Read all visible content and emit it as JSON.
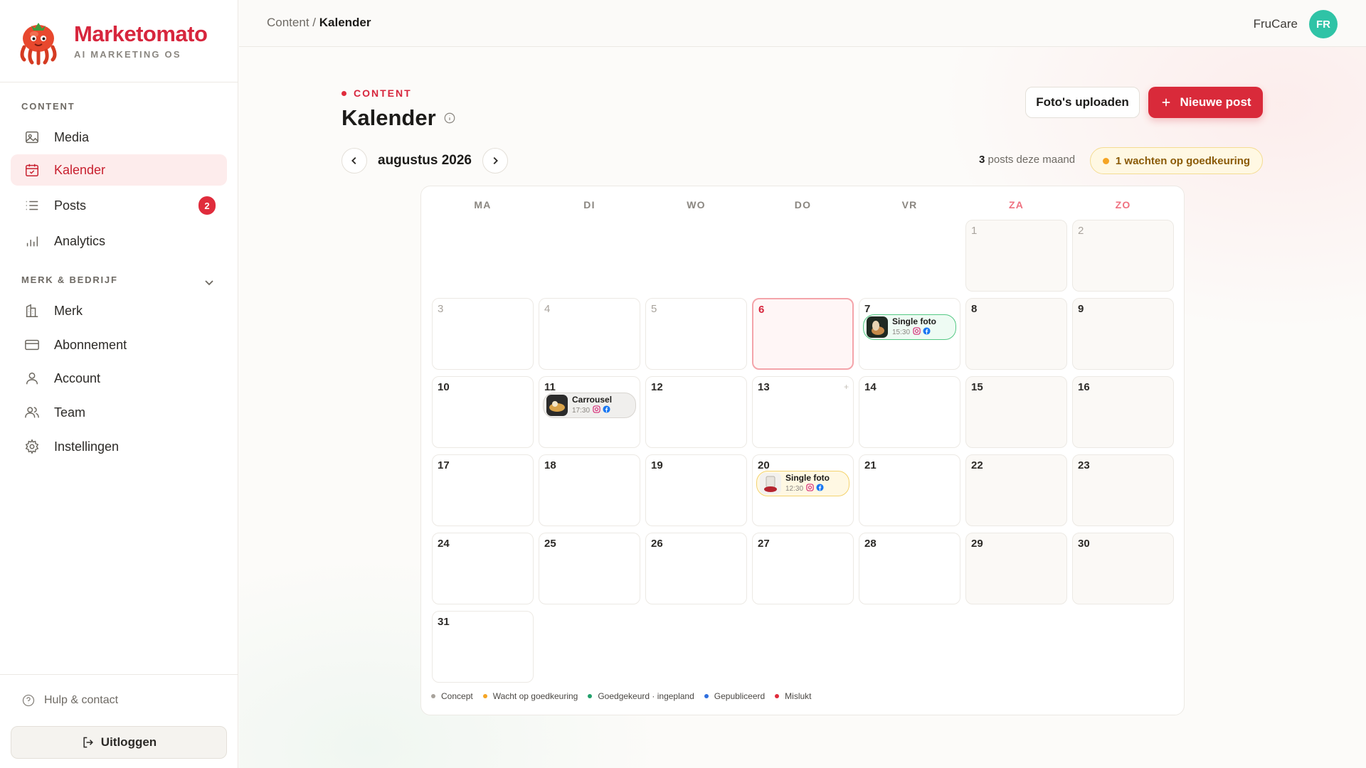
{
  "brand": {
    "name": "Marketomato",
    "tagline": "AI MARKETING OS"
  },
  "sidebar": {
    "content_label": "CONTENT",
    "items": [
      {
        "label": "Media",
        "icon": "image-icon"
      },
      {
        "label": "Kalender",
        "icon": "calendar-icon",
        "active": true
      },
      {
        "label": "Posts",
        "icon": "list-icon",
        "badge": "2"
      },
      {
        "label": "Analytics",
        "icon": "bar-chart-icon"
      }
    ],
    "company_label": "MERK & BEDRIJF",
    "company_items": [
      {
        "label": "Merk",
        "icon": "building-icon"
      },
      {
        "label": "Abonnement",
        "icon": "credit-card-icon"
      },
      {
        "label": "Account",
        "icon": "user-icon"
      },
      {
        "label": "Team",
        "icon": "users-icon"
      },
      {
        "label": "Instellingen",
        "icon": "gear-icon"
      }
    ],
    "help": "Hulp & contact",
    "logout": "Uitloggen"
  },
  "topbar": {
    "breadcrumb_parent": "Content",
    "breadcrumb_sep": "/",
    "breadcrumb_current": "Kalender",
    "user_name": "FruCare",
    "avatar_initials": "FR"
  },
  "header": {
    "eyebrow": "CONTENT",
    "title": "Kalender",
    "upload_button": "Foto's uploaden",
    "new_post_button": "Nieuwe post"
  },
  "month": {
    "label": "augustus 2026",
    "post_count": "3",
    "post_count_suffix": "posts deze maand",
    "pending": "1 wachten op goedkeuring"
  },
  "calendar": {
    "weekdays": [
      "MA",
      "DI",
      "WO",
      "DO",
      "VR",
      "ZA",
      "ZO"
    ],
    "today": 6,
    "days": [
      1,
      2,
      3,
      4,
      5,
      6,
      7,
      8,
      9,
      10,
      11,
      12,
      13,
      14,
      15,
      16,
      17,
      18,
      19,
      20,
      21,
      22,
      23,
      24,
      25,
      26,
      27,
      28,
      29,
      30,
      31
    ],
    "posts": [
      {
        "day": 7,
        "title": "Single foto",
        "time": "15:30",
        "status": "approved"
      },
      {
        "day": 11,
        "title": "Carrousel",
        "time": "17:30",
        "status": "concept"
      },
      {
        "day": 20,
        "title": "Single foto",
        "time": "12:30",
        "status": "pending"
      }
    ]
  },
  "legend": [
    {
      "label": "Concept",
      "color": "#a8a39c"
    },
    {
      "label": "Wacht op goedkeuring",
      "color": "#f5a524"
    },
    {
      "label": "Goedgekeurd · ingepland",
      "color": "#22a06b"
    },
    {
      "label": "Gepubliceerd",
      "color": "#2f6fde"
    },
    {
      "label": "Mislukt",
      "color": "#e02c3c"
    }
  ],
  "colors": {
    "accent": "#d92a3a",
    "avatar": "#2fc3a6"
  }
}
